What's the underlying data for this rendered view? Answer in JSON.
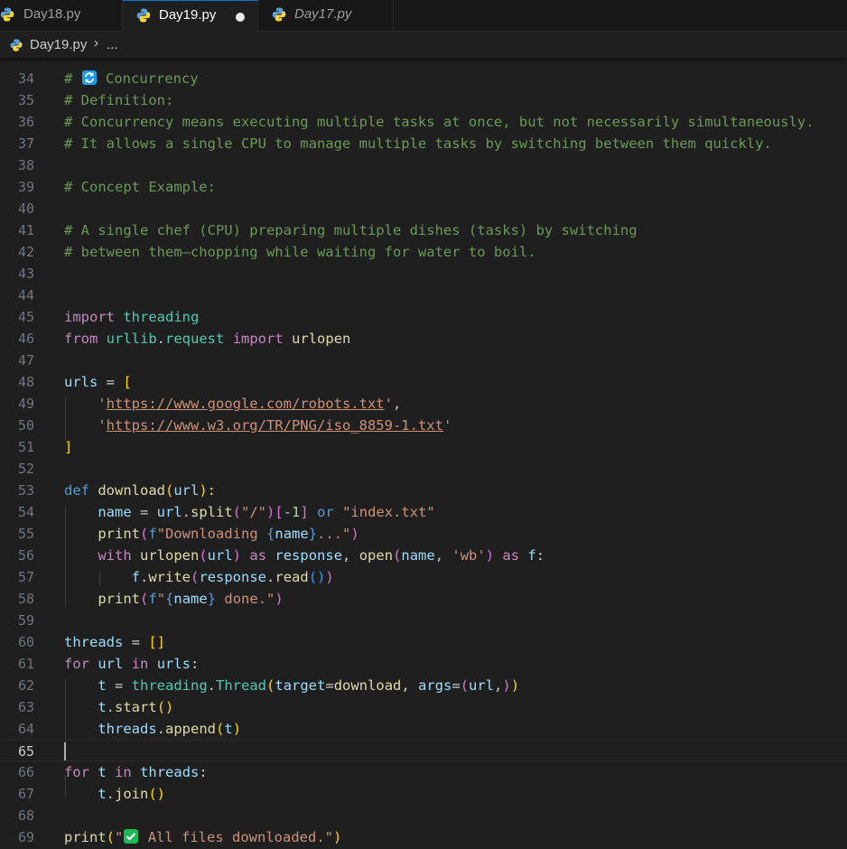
{
  "tabs": [
    {
      "label": "Day18.py",
      "icon": "python-icon"
    },
    {
      "label": "Day19.py",
      "icon": "python-icon",
      "active": true,
      "modified": true
    },
    {
      "label": "Day17.py",
      "icon": "python-icon",
      "preview": true
    }
  ],
  "breadcrumb": {
    "file": "Day19.py",
    "more": "..."
  },
  "colors": {
    "comment": "#6a9955",
    "keyword": "#c586c0",
    "string": "#ce9178",
    "function": "#dcdcaa",
    "variable": "#9cdcfe",
    "class": "#4ec9b0",
    "accent": "#0078d4"
  },
  "editor": {
    "current_line": "65",
    "lines": [
      {
        "num": "34",
        "t": [
          "# ",
          " Concurrency"
        ]
      },
      {
        "num": "35",
        "t": [
          "# Definition:"
        ]
      },
      {
        "num": "36",
        "t": [
          "# Concurrency means executing multiple tasks at once, but not necessarily simultaneously."
        ]
      },
      {
        "num": "37",
        "t": [
          "# It allows a single CPU to manage multiple tasks by switching between them quickly."
        ]
      },
      {
        "num": "38",
        "t": []
      },
      {
        "num": "39",
        "t": [
          "# Concept Example:"
        ]
      },
      {
        "num": "40",
        "t": []
      },
      {
        "num": "41",
        "t": [
          "# A single chef (CPU) preparing multiple dishes (tasks) by switching"
        ]
      },
      {
        "num": "42",
        "t": [
          "# between them—chopping while waiting for water to boil."
        ]
      },
      {
        "num": "43",
        "t": []
      },
      {
        "num": "44",
        "t": []
      },
      {
        "num": "45",
        "t": [
          "import",
          " ",
          "threading"
        ]
      },
      {
        "num": "46",
        "t": [
          "from",
          " ",
          "urllib",
          ".",
          "request",
          " ",
          "import",
          " ",
          "urlopen"
        ]
      },
      {
        "num": "47",
        "t": []
      },
      {
        "num": "48",
        "t": [
          "urls",
          " = ",
          "["
        ]
      },
      {
        "num": "49",
        "t": [
          "    ",
          "'",
          "https://www.google.com/robots.txt",
          "'",
          ","
        ]
      },
      {
        "num": "50",
        "t": [
          "    ",
          "'",
          "https://www.w3.org/TR/PNG/iso_8859-1.txt",
          "'"
        ]
      },
      {
        "num": "51",
        "t": [
          "]"
        ]
      },
      {
        "num": "52",
        "t": []
      },
      {
        "num": "53",
        "t": [
          "def",
          " ",
          "download",
          "(",
          "url",
          "):"
        ]
      },
      {
        "num": "54",
        "t": [
          "    ",
          "name",
          " = ",
          "url",
          ".",
          "split",
          "(",
          "\"/\"",
          ")",
          "[",
          "-1",
          "]",
          " ",
          "or",
          " ",
          "\"index.txt\""
        ]
      },
      {
        "num": "55",
        "t": [
          "    ",
          "print",
          "(",
          "f",
          "\"Downloading ",
          "{",
          "name",
          "}",
          "...\"",
          ")"
        ]
      },
      {
        "num": "56",
        "t": [
          "    ",
          "with",
          " ",
          "urlopen",
          "(",
          "url",
          ")",
          " ",
          "as",
          " ",
          "response",
          ", ",
          "open",
          "(",
          "name",
          ", ",
          "'wb'",
          ")",
          " ",
          "as",
          " ",
          "f",
          ":"
        ]
      },
      {
        "num": "57",
        "t": [
          "        ",
          "f",
          ".",
          "write",
          "(",
          "response",
          ".",
          "read",
          "()",
          ")"
        ]
      },
      {
        "num": "58",
        "t": [
          "    ",
          "print",
          "(",
          "f",
          "\"",
          "{",
          "name",
          "}",
          " done.\"",
          ")"
        ]
      },
      {
        "num": "59",
        "t": []
      },
      {
        "num": "60",
        "t": [
          "threads",
          " = ",
          "[]"
        ]
      },
      {
        "num": "61",
        "t": [
          "for",
          " ",
          "url",
          " ",
          "in",
          " ",
          "urls",
          ":"
        ]
      },
      {
        "num": "62",
        "t": [
          "    ",
          "t",
          " = ",
          "threading",
          ".",
          "Thread",
          "(",
          "target",
          "=",
          "download",
          ", ",
          "args",
          "=",
          "(",
          "url",
          ",",
          ")",
          ")"
        ]
      },
      {
        "num": "63",
        "t": [
          "    ",
          "t",
          ".",
          "start",
          "()"
        ]
      },
      {
        "num": "64",
        "t": [
          "    ",
          "threads",
          ".",
          "append",
          "(",
          "t",
          ")"
        ]
      },
      {
        "num": "65",
        "t": []
      },
      {
        "num": "66",
        "t": [
          "for",
          " ",
          "t",
          " ",
          "in",
          " ",
          "threads",
          ":"
        ]
      },
      {
        "num": "67",
        "t": [
          "    ",
          "t",
          ".",
          "join",
          "()"
        ]
      },
      {
        "num": "68",
        "t": []
      },
      {
        "num": "69",
        "t": [
          "print",
          "(",
          "\"",
          " All files downloaded.\"",
          ")"
        ]
      }
    ]
  }
}
